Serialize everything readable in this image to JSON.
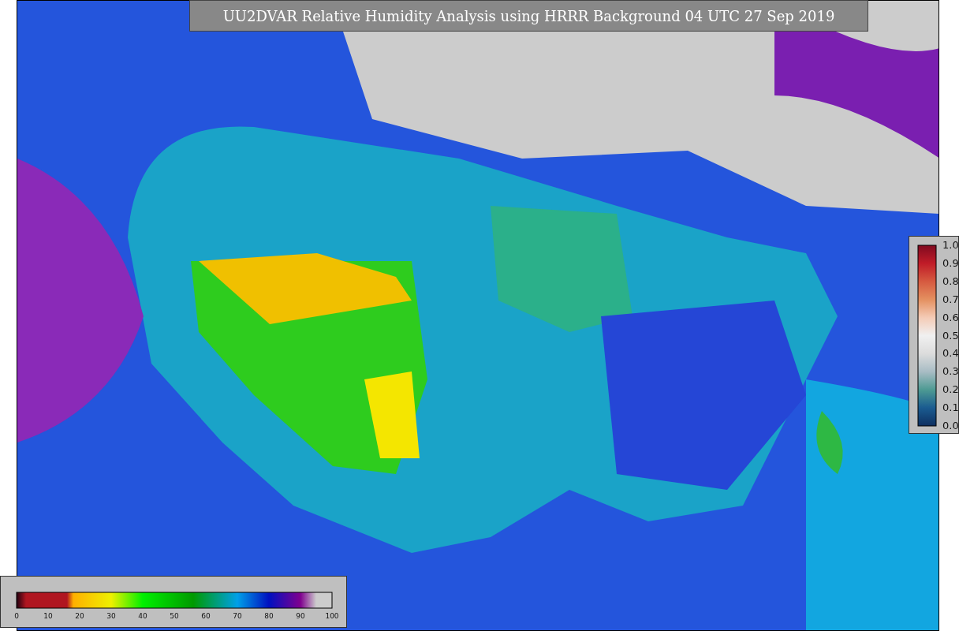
{
  "title": "UU2DVAR Relative Humidity Analysis using HRRR Background 04 UTC 27 Sep 2019",
  "station_legend": {
    "ticks": [
      "1.0",
      "0.9",
      "0.8",
      "0.7",
      "0.6",
      "0.5",
      "0.4",
      "0.3",
      "0.2",
      "0.1",
      "0.0"
    ]
  },
  "humidity_legend": {
    "ticks": [
      "0",
      "10",
      "20",
      "30",
      "40",
      "50",
      "60",
      "70",
      "80",
      "90",
      "100"
    ]
  }
}
